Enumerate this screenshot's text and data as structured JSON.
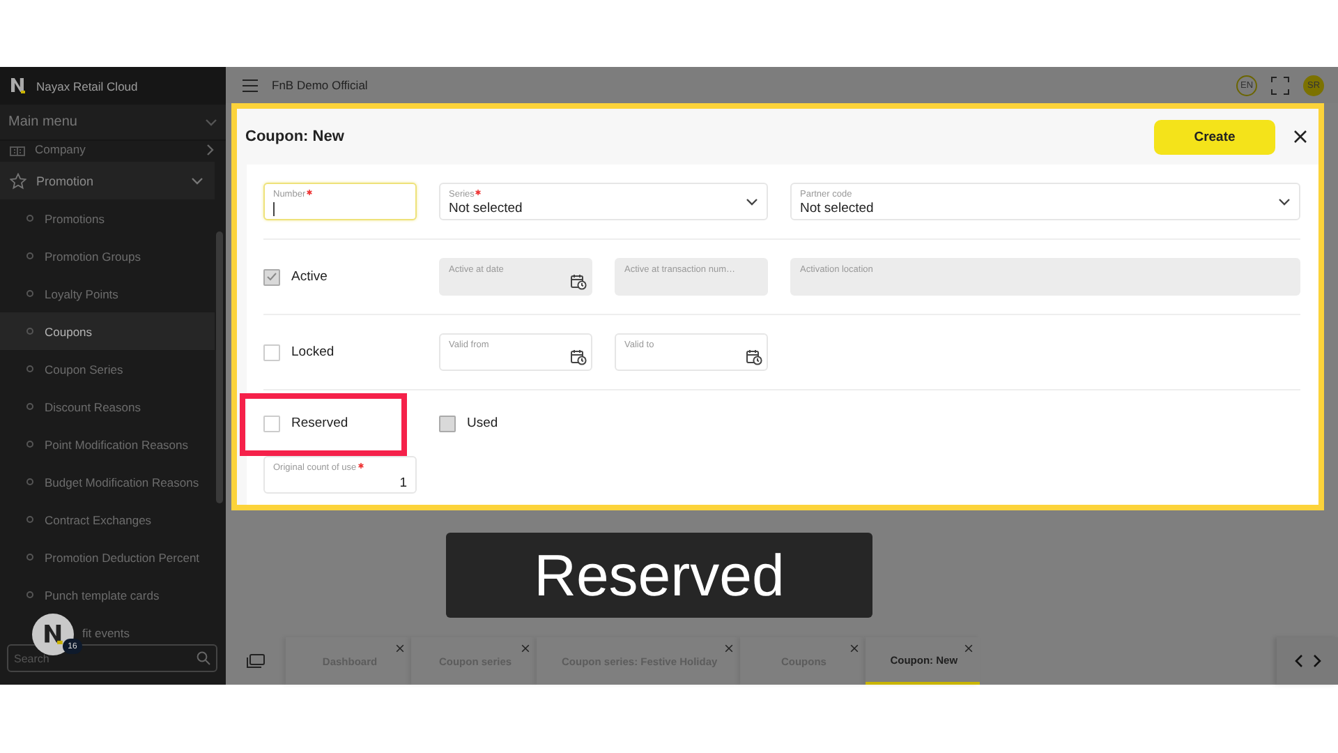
{
  "sidebar": {
    "brand": "Nayax Retail Cloud",
    "menu_title": "Main menu",
    "items": [
      {
        "label": "Company",
        "expanded": false
      },
      {
        "label": "Promotion",
        "expanded": true,
        "children": [
          {
            "label": "Promotions",
            "selected": false
          },
          {
            "label": "Promotion Groups",
            "selected": false
          },
          {
            "label": "Loyalty Points",
            "selected": false
          },
          {
            "label": "Coupons",
            "selected": true
          },
          {
            "label": "Coupon Series",
            "selected": false
          },
          {
            "label": "Discount Reasons",
            "selected": false
          },
          {
            "label": "Point Modification Reasons",
            "selected": false
          },
          {
            "label": "Budget Modification Reasons",
            "selected": false
          },
          {
            "label": "Contract Exchanges",
            "selected": false
          },
          {
            "label": "Promotion Deduction Percent",
            "selected": false
          },
          {
            "label": "Punch template cards",
            "selected": false
          },
          {
            "label": "fit events",
            "selected": false
          }
        ]
      }
    ],
    "chat_badge": "16",
    "search": {
      "placeholder": "Search"
    }
  },
  "topbar": {
    "title": "FnB Demo Official",
    "language": "EN",
    "user_initials": "SR"
  },
  "dialog": {
    "title": "Coupon: New",
    "create_button": "Create",
    "rows": [
      {
        "fields": [
          {
            "kind": "text",
            "label": "Number",
            "required": true,
            "focused": true,
            "disabled": false,
            "highlighted": false
          },
          {
            "kind": "select",
            "label": "Series",
            "required": true,
            "value": "Not selected",
            "focused": false,
            "disabled": false,
            "highlighted": false
          },
          {
            "kind": "select",
            "label": "Partner code",
            "required": false,
            "value": "Not selected",
            "focused": false,
            "disabled": false,
            "highlighted": false
          }
        ]
      },
      {
        "fields": [
          {
            "kind": "checkbox",
            "label": "Active",
            "checked": true,
            "disabled": true,
            "highlighted": false
          },
          {
            "kind": "date",
            "label": "Active at date",
            "required": false,
            "focused": false,
            "disabled": true,
            "highlighted": false
          },
          {
            "kind": "text",
            "label": "Active at transaction num…",
            "required": false,
            "focused": false,
            "disabled": true,
            "highlighted": false
          },
          {
            "kind": "text",
            "label": "Activation location",
            "required": false,
            "focused": false,
            "disabled": true,
            "highlighted": false
          }
        ]
      },
      {
        "fields": [
          {
            "kind": "checkbox",
            "label": "Locked",
            "checked": false,
            "disabled": false,
            "highlighted": false
          },
          {
            "kind": "date",
            "label": "Valid from",
            "required": false,
            "focused": false,
            "disabled": false,
            "highlighted": false
          },
          {
            "kind": "date",
            "label": "Valid to",
            "required": false,
            "focused": false,
            "disabled": false,
            "highlighted": false
          }
        ]
      },
      {
        "fields": [
          {
            "kind": "checkbox",
            "label": "Reserved",
            "checked": false,
            "disabled": false,
            "highlighted": true
          },
          {
            "kind": "checkbox",
            "label": "Used",
            "checked": false,
            "disabled": true,
            "highlighted": false
          }
        ]
      },
      {
        "fields": [
          {
            "kind": "number",
            "label": "Original count of use",
            "required": true,
            "value": "1",
            "focused": false,
            "disabled": false,
            "highlighted": false
          }
        ]
      }
    ]
  },
  "tabs": [
    {
      "label": "Dashboard",
      "selected": false
    },
    {
      "label": "Coupon series",
      "selected": false
    },
    {
      "label": "Coupon series: Festive Holiday",
      "selected": false
    },
    {
      "label": "Coupons",
      "selected": false
    },
    {
      "label": "Coupon: New",
      "selected": true
    }
  ],
  "caption": "Reserved"
}
